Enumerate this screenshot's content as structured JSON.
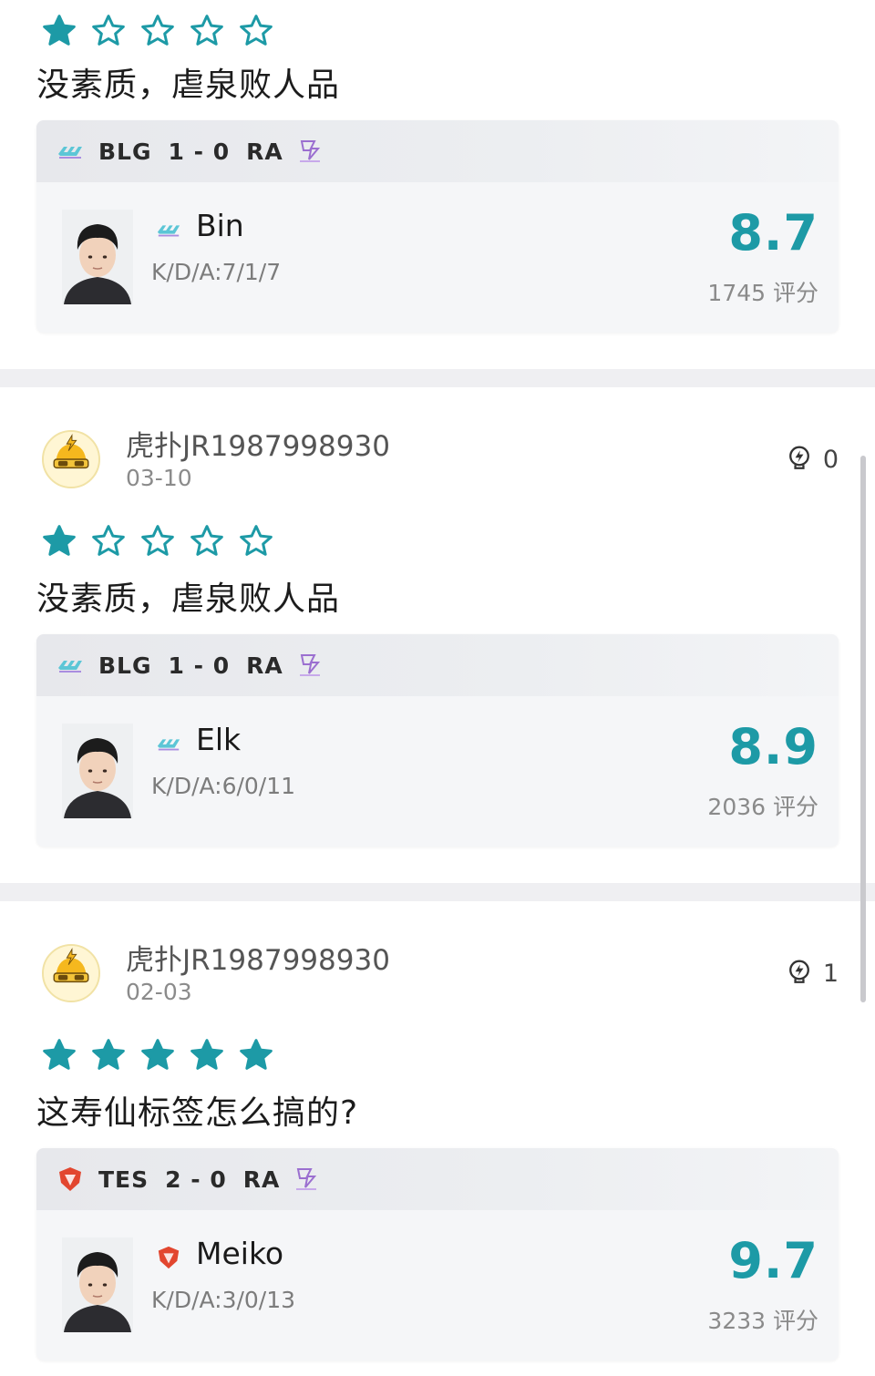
{
  "colors": {
    "accent": "#1d9aa6",
    "star_filled": "#1d9aa6",
    "separator": "#efeff2",
    "card_bg": "#f5f6f8"
  },
  "reviews": [
    {
      "username": "",
      "date": "",
      "likes": "",
      "rating_stars": 1,
      "comment": "没素质，虐泉败人品",
      "match": {
        "team1": "BLG",
        "score": "1 - 0",
        "team2": "RA"
      },
      "player": {
        "name": "Bin",
        "kda": "K/D/A:7/1/7",
        "score": "8.7",
        "rating_count": "1745 评分",
        "team_icon": "blg-logo-icon"
      }
    },
    {
      "username": "虎扑JR1987998930",
      "date": "03-10",
      "likes": "0",
      "rating_stars": 1,
      "comment": "没素质，虐泉败人品",
      "match": {
        "team1": "BLG",
        "score": "1 - 0",
        "team2": "RA"
      },
      "player": {
        "name": "Elk",
        "kda": "K/D/A:6/0/11",
        "score": "8.9",
        "rating_count": "2036 评分",
        "team_icon": "blg-logo-icon"
      }
    },
    {
      "username": "虎扑JR1987998930",
      "date": "02-03",
      "likes": "1",
      "rating_stars": 5,
      "comment": "这寿仙标签怎么搞的?",
      "match": {
        "team1": "TES",
        "score": "2 - 0",
        "team2": "RA"
      },
      "player": {
        "name": "Meiko",
        "kda": "K/D/A:3/0/13",
        "score": "9.7",
        "rating_count": "3233 评分",
        "team_icon": "tes-logo-icon"
      }
    }
  ]
}
